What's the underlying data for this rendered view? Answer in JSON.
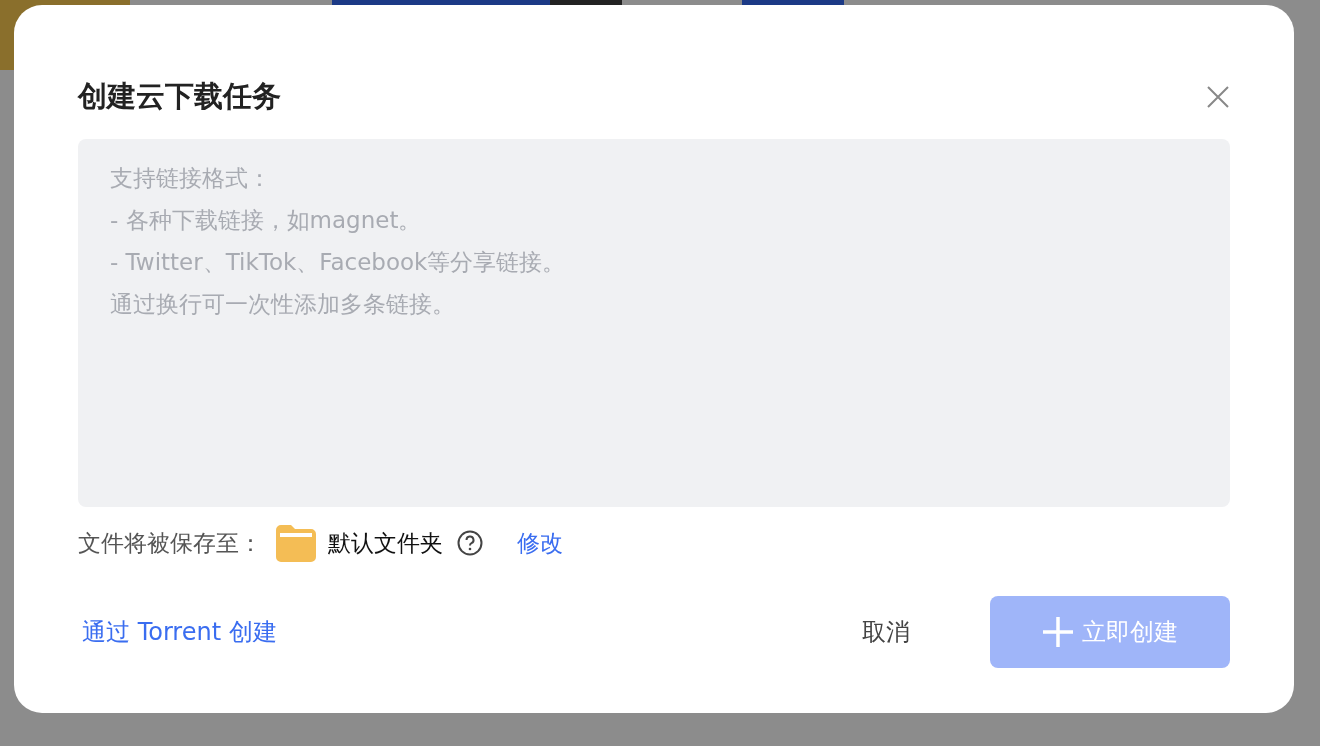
{
  "dialog": {
    "title": "创建云下载任务",
    "link_input": {
      "placeholder": [
        "支持链接格式：",
        "- 各种下载链接，如magnet。",
        "- Twitter、TikTok、Facebook等分享链接。",
        "通过换行可一次性添加多条链接。"
      ]
    },
    "save_location": {
      "label": "文件将被保存至：",
      "folder": "默认文件夹",
      "change_link": "修改"
    },
    "torrent_link": "通过 Torrent 创建",
    "cancel_button": "取消",
    "create_button": {
      "label": "立即创建",
      "disabled": true
    }
  }
}
